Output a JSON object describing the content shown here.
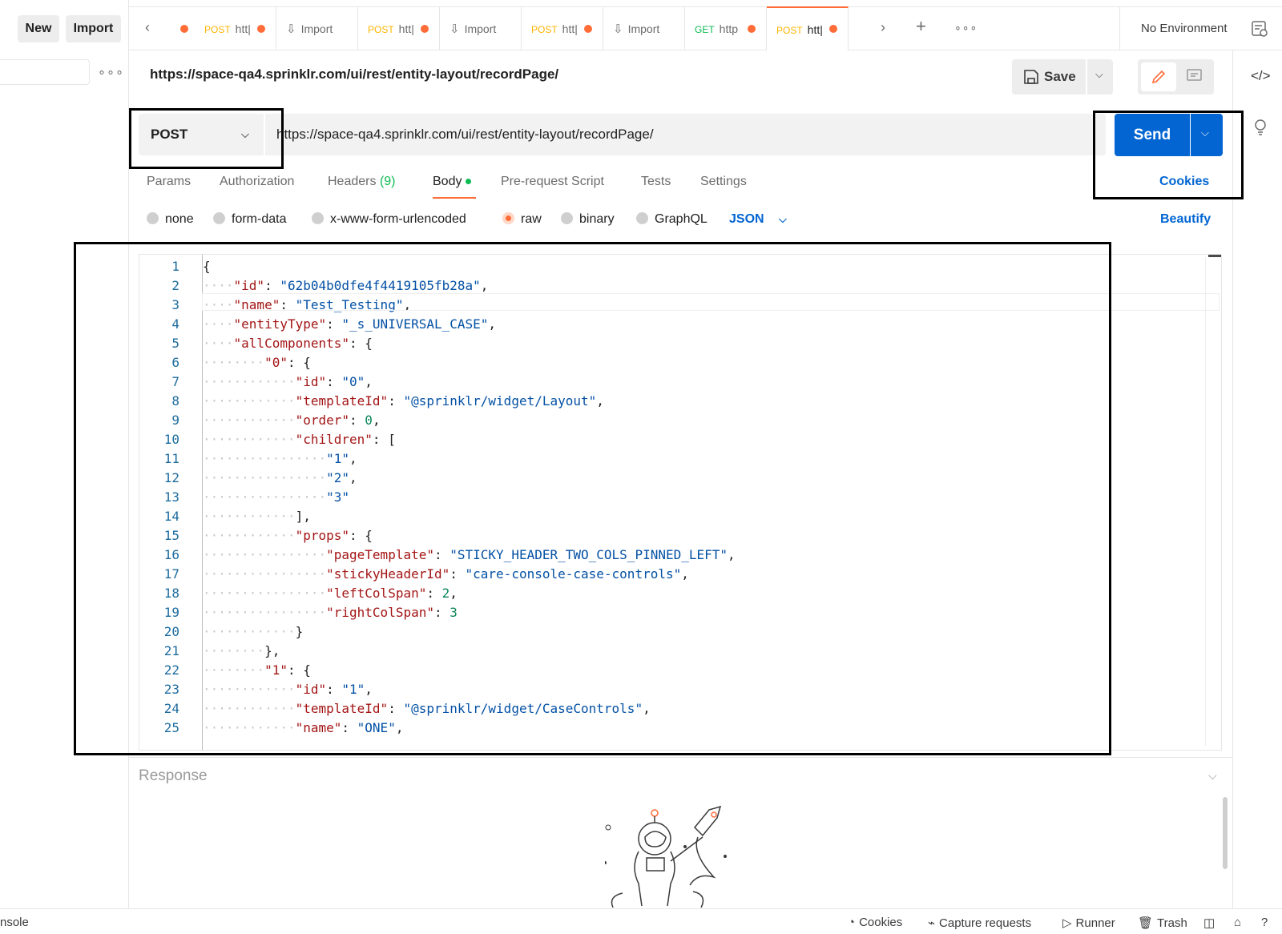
{
  "sidebar": {
    "new_label": "New",
    "import_label": "Import"
  },
  "tabs": [
    {
      "method": "POST",
      "label": "htt|",
      "type": "request"
    },
    {
      "method": "",
      "label": "Import",
      "type": "import"
    },
    {
      "method": "POST",
      "label": "htt|",
      "type": "request"
    },
    {
      "method": "",
      "label": "Import",
      "type": "import"
    },
    {
      "method": "POST",
      "label": "htt|",
      "type": "request"
    },
    {
      "method": "",
      "label": "Import",
      "type": "import"
    },
    {
      "method": "GET",
      "label": "http",
      "type": "request"
    },
    {
      "method": "POST",
      "label": "htt|",
      "type": "request",
      "active": true
    }
  ],
  "environment": {
    "label": "No Environment"
  },
  "request": {
    "title": "https://space-qa4.sprinklr.com/ui/rest/entity-layout/recordPage/",
    "method": "POST",
    "url": "https://space-qa4.sprinklr.com/ui/rest/entity-layout/recordPage/",
    "save_label": "Save",
    "send_label": "Send",
    "cookies_label": "Cookies"
  },
  "request_tabs": {
    "params": "Params",
    "authorization": "Authorization",
    "headers": "Headers",
    "headers_count": "(9)",
    "body": "Body",
    "prerequest": "Pre-request Script",
    "tests": "Tests",
    "settings": "Settings"
  },
  "body_modes": {
    "none": "none",
    "form_data": "form-data",
    "urlencoded": "x-www-form-urlencoded",
    "raw": "raw",
    "binary": "binary",
    "graphql": "GraphQL",
    "language": "JSON",
    "beautify": "Beautify",
    "selected": "raw"
  },
  "editor": {
    "lines": [
      "{",
      "    \"id\": \"62b04b0dfe4f4419105fb28a\",",
      "    \"name\": \"Test_Testing\",",
      "    \"entityType\": \"_s_UNIVERSAL_CASE\",",
      "    \"allComponents\": {",
      "        \"0\": {",
      "            \"id\": \"0\",",
      "            \"templateId\": \"@sprinklr/widget/Layout\",",
      "            \"order\": 0,",
      "            \"children\": [",
      "                \"1\",",
      "                \"2\",",
      "                \"3\"",
      "            ],",
      "            \"props\": {",
      "                \"pageTemplate\": \"STICKY_HEADER_TWO_COLS_PINNED_LEFT\",",
      "                \"stickyHeaderId\": \"care-console-case-controls\",",
      "                \"leftColSpan\": 2,",
      "                \"rightColSpan\": 3",
      "            }",
      "        },",
      "        \"1\": {",
      "            \"id\": \"1\",",
      "            \"templateId\": \"@sprinklr/widget/CaseControls\",",
      "            \"name\": \"ONE\","
    ]
  },
  "response": {
    "label": "Response"
  },
  "statusbar": {
    "console": "nsole",
    "cookies": "Cookies",
    "capture": "Capture requests",
    "runner": "Runner",
    "trash": "Trash"
  }
}
